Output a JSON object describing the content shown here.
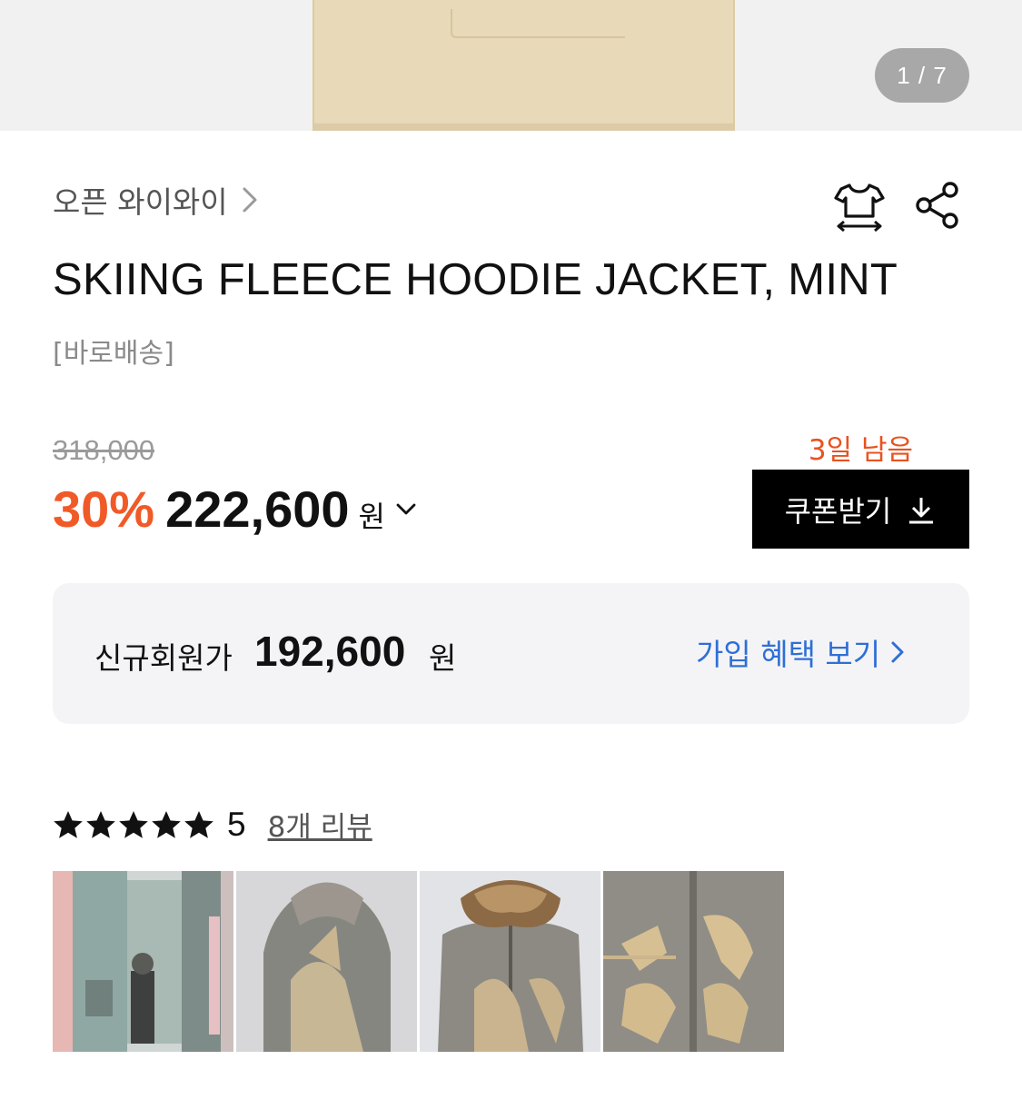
{
  "gallery": {
    "counter": "1 / 7"
  },
  "brand": {
    "name": "오픈 와이와이"
  },
  "product": {
    "title": "SKIING FLEECE HOODIE JACKET, MINT",
    "delivery_tag": "[바로배송]"
  },
  "price": {
    "original": "318,000",
    "discount_rate": "30%",
    "sale": "222,600",
    "currency": "원"
  },
  "coupon": {
    "days_left": "3일 남음",
    "button_label": "쿠폰받기"
  },
  "member_offer": {
    "label": "신규회원가",
    "price": "192,600",
    "currency": "원",
    "link_label": "가입 혜택 보기"
  },
  "reviews": {
    "stars": 5,
    "score": "5",
    "link_label": "8개 리뷰",
    "thumbnails": [
      "review-photo-1",
      "review-photo-2",
      "review-photo-3",
      "review-photo-4"
    ]
  },
  "colors": {
    "accent_orange": "#f05a28",
    "link_blue": "#2f6fd6",
    "coupon_bg": "#000000"
  },
  "icons": {
    "size_guide": "tshirt-size-icon",
    "share": "share-icon",
    "brand_chevron": "chevron-right-icon",
    "price_toggle": "chevron-down-icon",
    "download": "download-icon",
    "star": "star-icon"
  }
}
